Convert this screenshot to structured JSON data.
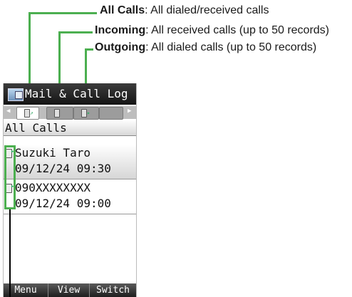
{
  "callouts": [
    {
      "term": "All Calls",
      "desc": ": All dialed/received calls"
    },
    {
      "term": "Incoming",
      "desc": ": All received calls (up to 50 records)"
    },
    {
      "term": "Outgoing",
      "desc": ": All dialed calls (up to 50 records)"
    }
  ],
  "screen": {
    "title": "Mail & Call Log",
    "title_icon": "mail-call-log-icon",
    "tab_icons": [
      "all-calls-tab-icon",
      "incoming-tab-icon",
      "outgoing-tab-icon"
    ],
    "current_tab_label": "All Calls",
    "calls": [
      {
        "icon": "outgoing-call-icon",
        "name": "Suzuki Taro",
        "time": "09/12/24 09:30"
      },
      {
        "icon": "outgoing-call-icon",
        "name": "090XXXXXXXX",
        "time": "09/12/24 09:00"
      }
    ],
    "softkeys": [
      "Menu",
      "View",
      "Switch"
    ]
  },
  "colors": {
    "callout_line": "#4caf50",
    "titlebar": "#1e1e1e",
    "tab_bar": "#bdbdbd"
  }
}
